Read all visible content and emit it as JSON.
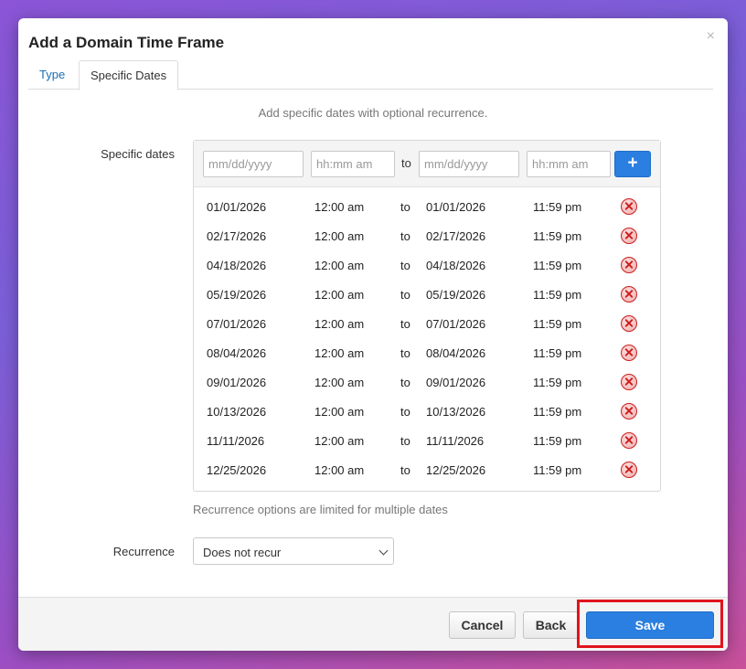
{
  "modal": {
    "title": "Add a Domain Time Frame",
    "close_glyph": "×"
  },
  "tabs": [
    {
      "label": "Type",
      "active": false
    },
    {
      "label": "Specific Dates",
      "active": true
    }
  ],
  "subtitle": "Add specific dates with optional recurrence.",
  "specific_dates": {
    "label": "Specific dates",
    "entry": {
      "start_date_placeholder": "mm/dd/yyyy",
      "start_time_placeholder": "hh:mm am",
      "to_label": "to",
      "end_date_placeholder": "mm/dd/yyyy",
      "end_time_placeholder": "hh:mm am",
      "add_glyph": "+"
    },
    "rows": [
      {
        "start_date": "01/01/2026",
        "start_time": "12:00 am",
        "to": "to",
        "end_date": "01/01/2026",
        "end_time": "11:59 pm"
      },
      {
        "start_date": "02/17/2026",
        "start_time": "12:00 am",
        "to": "to",
        "end_date": "02/17/2026",
        "end_time": "11:59 pm"
      },
      {
        "start_date": "04/18/2026",
        "start_time": "12:00 am",
        "to": "to",
        "end_date": "04/18/2026",
        "end_time": "11:59 pm"
      },
      {
        "start_date": "05/19/2026",
        "start_time": "12:00 am",
        "to": "to",
        "end_date": "05/19/2026",
        "end_time": "11:59 pm"
      },
      {
        "start_date": "07/01/2026",
        "start_time": "12:00 am",
        "to": "to",
        "end_date": "07/01/2026",
        "end_time": "11:59 pm"
      },
      {
        "start_date": "08/04/2026",
        "start_time": "12:00 am",
        "to": "to",
        "end_date": "08/04/2026",
        "end_time": "11:59 pm"
      },
      {
        "start_date": "09/01/2026",
        "start_time": "12:00 am",
        "to": "to",
        "end_date": "09/01/2026",
        "end_time": "11:59 pm"
      },
      {
        "start_date": "10/13/2026",
        "start_time": "12:00 am",
        "to": "to",
        "end_date": "10/13/2026",
        "end_time": "11:59 pm"
      },
      {
        "start_date": "11/11/2026",
        "start_time": "12:00 am",
        "to": "to",
        "end_date": "11/11/2026",
        "end_time": "11:59 pm"
      },
      {
        "start_date": "12/25/2026",
        "start_time": "12:00 am",
        "to": "to",
        "end_date": "12/25/2026",
        "end_time": "11:59 pm"
      }
    ],
    "note": "Recurrence options are limited for multiple dates"
  },
  "recurrence": {
    "label": "Recurrence",
    "selected": "Does not recur"
  },
  "footer": {
    "cancel_label": "Cancel",
    "back_label": "Back",
    "save_label": "Save"
  },
  "colors": {
    "primary": "#2a7fe0",
    "link": "#1a6fb5",
    "delete": "#cc1f1f",
    "highlight": "#e0141e"
  },
  "icons": {
    "add": "plus-icon",
    "delete": "remove-circle-icon",
    "close": "close-icon",
    "dropdown": "chevron-down-icon"
  }
}
